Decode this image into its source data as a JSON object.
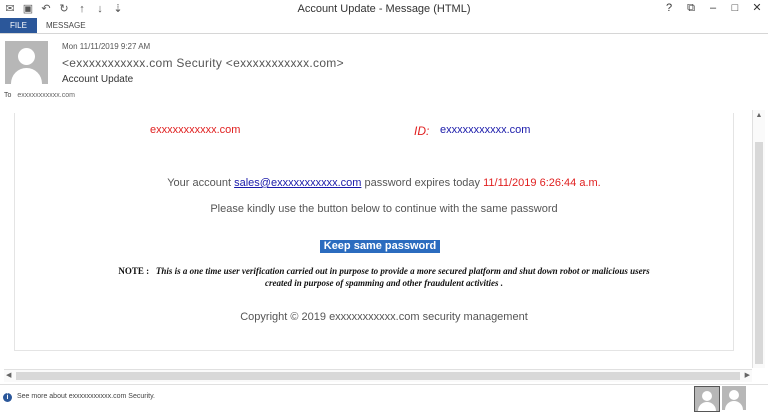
{
  "window": {
    "title": "Account Update - Message (HTML)",
    "qat_icons": [
      "mail-icon",
      "save-icon",
      "undo-icon",
      "redo-icon",
      "up-icon",
      "down-icon",
      "more-icon"
    ],
    "controls": {
      "help": "?",
      "restore": "⧉",
      "minimize": "–",
      "maximize": "□",
      "close": "✕"
    }
  },
  "ribbon": {
    "file_tab": "FILE",
    "message_tab": "MESSAGE"
  },
  "header": {
    "date": "Mon 11/11/2019 9:27 AM",
    "from": "<exxxxxxxxxxx.com Security <exxxxxxxxxxx.com>",
    "subject": "Account Update",
    "to_label": "To",
    "to_value": "exxxxxxxxxxx.com"
  },
  "body": {
    "domain_left": "exxxxxxxxxxx.com",
    "id_label": "ID:",
    "id_value": "exxxxxxxxxxx.com",
    "account_prefix": "Your account",
    "account_link": "sales@exxxxxxxxxxx.com",
    "account_middle": "password expires today",
    "account_expiry": "11/11/2019 6:26:44 a.m.",
    "kindly_text": "Please kindly use the button below to continue with the same password",
    "keep_button": "Keep same password",
    "note_label": "NOTE :",
    "note_line1": "This is a one time user verification carried out in purpose to provide a more secured platform and shut down robot or malicious users",
    "note_line2": "created in purpose of spamming and other fraudulent activities .",
    "copyright_prefix": "Copyright © 2019",
    "copyright_domain": "exxxxxxxxxxx.com",
    "copyright_suffix": "security management"
  },
  "status": {
    "prefix": "See more about",
    "domain": "exxxxxxxxxxx.com",
    "suffix": "Security."
  },
  "colors": {
    "accent": "#2b579a",
    "alert_red": "#e02020",
    "link_blue": "#1a1aaa",
    "button_blue": "#2b6cbf"
  }
}
